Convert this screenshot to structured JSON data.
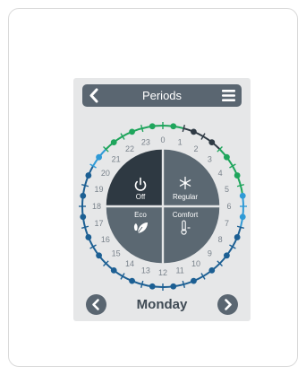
{
  "header": {
    "title": "Periods",
    "back_icon": "chevron-left-icon",
    "menu_icon": "hamburger-menu-icon"
  },
  "dial": {
    "hours": [
      "0",
      "1",
      "2",
      "3",
      "4",
      "5",
      "6",
      "7",
      "8",
      "9",
      "10",
      "11",
      "12",
      "13",
      "14",
      "15",
      "16",
      "17",
      "18",
      "19",
      "20",
      "21",
      "22",
      "23"
    ],
    "modes": {
      "off": {
        "label": "Off",
        "icon": "power-icon"
      },
      "regular": {
        "label": "Regular",
        "icon": "snowflake-icon"
      },
      "eco": {
        "label": "Eco",
        "icon": "leaf-icon"
      },
      "comfort": {
        "label": "Comfort",
        "icon": "thermometer-icon"
      }
    },
    "colors": {
      "off": "#2f3a44",
      "regular": "#1fa55c",
      "eco": "#2f9ad6",
      "comfort": "#1c5f93",
      "quad_dark": "#2e3942",
      "quad_mid": "#5b6872"
    },
    "ring_segments": [
      {
        "mode": "regular",
        "from_hour": 21,
        "to_hour": 24
      },
      {
        "mode": "regular",
        "from_hour": 0,
        "to_hour": 1
      },
      {
        "mode": "off",
        "from_hour": 1,
        "to_hour": 3
      },
      {
        "mode": "regular",
        "from_hour": 3,
        "to_hour": 5.5
      },
      {
        "mode": "eco",
        "from_hour": 5.5,
        "to_hour": 7
      },
      {
        "mode": "comfort",
        "from_hour": 7,
        "to_hour": 20
      },
      {
        "mode": "eco",
        "from_hour": 20,
        "to_hour": 21
      }
    ]
  },
  "footer": {
    "day": "Monday",
    "prev_icon": "chevron-left-icon",
    "next_icon": "chevron-right-icon"
  }
}
